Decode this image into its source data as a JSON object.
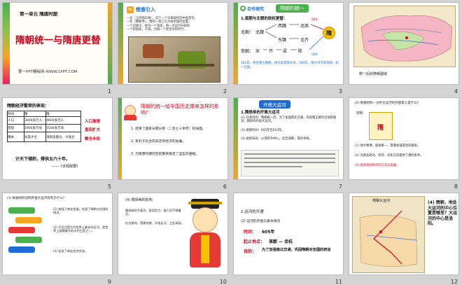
{
  "colors": {
    "red": "#d0021b",
    "orange": "#f5a623",
    "green": "#4caf50",
    "blue": "#1e6bd6",
    "dark": "#222222",
    "selection": "#f0a000"
  },
  "slides": [
    {
      "number": "1",
      "unit": "第一单元  隋唐时期",
      "title": "隋朝统一与隋唐更替",
      "footer": "第一PPT模板网-WWW.1PPT.COM"
    },
    {
      "number": "2",
      "heading": "情景引入",
      "text_lines": [
        "一天（王府韩风格），成了一个法律政权的中国皇帝，",
        "一年（隋朝寺），隋炀一统江东大统帝国的位置，",
        "一个诏赦令，统治一个国家，统一大运河开辟的",
        "一个新国家，干城，为统一个新皇帝的时代..."
      ]
    },
    {
      "number": "3",
      "section": "合作探究",
      "banner": "隋朝的统一",
      "q1": "1.南朝与北朝的政权更替：",
      "row_north_label": "北朝：",
      "row_south_label": "南朝：",
      "nodes": [
        "北魏",
        "西魏",
        "东魏",
        "北周",
        "北齐",
        "宋",
        "齐",
        "梁",
        "陈"
      ],
      "year_north": "581",
      "year_south": "589",
      "sui": "隋",
      "note": "581年，杨坚建立隋朝，杨坚就是隋文帝。589年，隋文帝灭陈南朝，统一全国。"
    },
    {
      "number": "4",
      "caption": "统一后的隋朝疆域"
    },
    {
      "number": "5",
      "title": "隋朝经济繁荣的表现：",
      "headers": [
        "时间\n内容",
        "隋",
        "隋"
      ],
      "rows": [
        [
          "人口",
          "3000多万人",
          "4600多万人"
        ],
        [
          "垦田",
          "1900多万顷",
          "5500多万顷"
        ],
        [
          "粮食",
          "长安大仓",
          "洛阳含嘉仓、兴洛仓"
        ]
      ],
      "tags": [
        "人口激增",
        "垦田扩大",
        "粮仓丰实"
      ],
      "quote": "计天下储积，得供五六十年。",
      "source": "——《贞观政要》"
    },
    {
      "number": "6",
      "question": "隋朝的统一给中国历史带来怎样的影响?",
      "points": [
        "1. 结束了国家长期分裂（二百七十余年）的局面。",
        "2. 有利于社会的安定和经济的发展。",
        "3. 为隋唐时期的空前繁荣奠定了坚实的基础。"
      ]
    },
    {
      "number": "7",
      "banner": "开凿大运河",
      "heading": "1.隋炀帝的开凿大运河",
      "paragraphs": [
        "(1) 开凿目的：隋朝统一后，为了加强南北交通，巩固隋王朝对全国的统治，隋炀帝开凿大运河。",
        "(2) 修建时间：605年至610年。",
        "(3) 规划布局：以洛阳为中心，北至涿郡，南达余杭。"
      ]
    },
    {
      "number": "8",
      "question": "(2) 根据材料一分析大运河的开凿意义是什么?",
      "sub": "材料",
      "sui": "隋",
      "items": [
        "(1) 地大物博，国家统一，需要加强南北的联系。",
        "(2) 为南北政治、经济、文化交流提供了便利条件。",
        "(3) 促进南北经济的交流与发展。"
      ]
    },
    {
      "number": "9",
      "question": "(1) 根据材料说明开凿大运河有利于什么?",
      "items": [
        "(1) 加强了南北交通，巩固了隋朝对全国的统治。",
        "(2) 大运河是古代世界上最长的运河，是世界上规模最大的水利工程之一。",
        "(3) 促进了南北经济交流。"
      ]
    },
    {
      "number": "10",
      "heading": "(4) 隋炀帝的影响",
      "lines": [
        "隋炀帝好大喜功，滥用民力，使人民不堪重负。",
        "在位期间，营建东都、开凿运河、三征高丽。"
      ]
    },
    {
      "number": "11",
      "heading": "2.运河的开通",
      "sub": "(2) 运河的开凿与基本情况",
      "time_label": "时间：",
      "time_value": "605年",
      "place_label": "起止地点：",
      "place_value": "涿郡 — 余杭",
      "purpose_label": "目的：",
      "purpose_value": "为了加强南北交通，巩固隋朝对全国的统治"
    },
    {
      "number": "12",
      "map_title": "隋朝大运河",
      "question": "(4) 隋朝，地处大运河的中心位置是哪里？大运河的中心是洛阳。"
    }
  ]
}
